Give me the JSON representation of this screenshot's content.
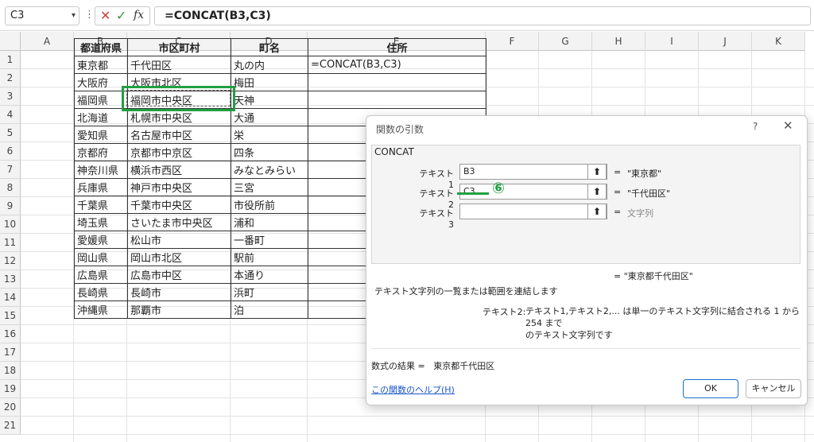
{
  "formula_bar": {
    "name_box": "C3",
    "formula": "=CONCAT(B3,C3)",
    "icons": [
      "cancel-icon",
      "enter-icon",
      "insert-function-icon"
    ]
  },
  "columns": [
    "A",
    "B",
    "C",
    "D",
    "E",
    "F",
    "G",
    "H",
    "I",
    "J",
    "K"
  ],
  "rows": [
    "1",
    "2",
    "3",
    "4",
    "5",
    "6",
    "7",
    "8",
    "9",
    "10",
    "11",
    "12",
    "13",
    "14",
    "15",
    "16",
    "17",
    "18",
    "19",
    "20",
    "21"
  ],
  "table": {
    "headers": [
      "都道府県",
      "市区町村",
      "町名",
      "住所"
    ],
    "rows": [
      [
        "東京都",
        "千代田区",
        "丸の内",
        "=CONCAT(B3,C3)"
      ],
      [
        "大阪府",
        "大阪市北区",
        "梅田",
        ""
      ],
      [
        "福岡県",
        "福岡市中央区",
        "天神",
        ""
      ],
      [
        "北海道",
        "札幌市中央区",
        "大通",
        ""
      ],
      [
        "愛知県",
        "名古屋市中区",
        "栄",
        ""
      ],
      [
        "京都府",
        "京都市中京区",
        "四条",
        ""
      ],
      [
        "神奈川県",
        "横浜市西区",
        "みなとみらい",
        ""
      ],
      [
        "兵庫県",
        "神戸市中央区",
        "三宮",
        ""
      ],
      [
        "千葉県",
        "千葉市中央区",
        "市役所前",
        ""
      ],
      [
        "埼玉県",
        "さいたま市中央区",
        "浦和",
        ""
      ],
      [
        "愛媛県",
        "松山市",
        "一番町",
        ""
      ],
      [
        "岡山県",
        "岡山市北区",
        "駅前",
        ""
      ],
      [
        "広島県",
        "広島市中区",
        "本通り",
        ""
      ],
      [
        "長崎県",
        "長崎市",
        "浜町",
        ""
      ],
      [
        "沖縄県",
        "那覇市",
        "泊",
        ""
      ]
    ]
  },
  "dialog": {
    "title": "関数の引数",
    "help_glyph": "?",
    "function_name": "CONCAT",
    "args": [
      {
        "label": "テキスト1",
        "value": "B3",
        "result": "\"東京都\""
      },
      {
        "label": "テキスト2",
        "value": "C3",
        "result": "\"千代田区\""
      },
      {
        "label": "テキスト3",
        "value": "",
        "result": "文字列"
      }
    ],
    "step_marker": "⑥",
    "overall_result": "\"東京都千代田区\"",
    "description": "テキスト文字列の一覧または範囲を連結します",
    "arg_desc_label": "テキスト2:",
    "arg_desc_line1": "テキスト1,テキスト2,...  は単一のテキスト文字列に結合される 1 から 254 まで",
    "arg_desc_line2": "のテキスト文字列です",
    "formula_result_label": "数式の結果 =",
    "formula_result_value": "東京都千代田区",
    "help_link": "この関数のヘルプ(H)",
    "ok": "OK",
    "cancel": "キャンセル"
  },
  "accent_color": "#21a040",
  "link_color": "#1a55c8"
}
